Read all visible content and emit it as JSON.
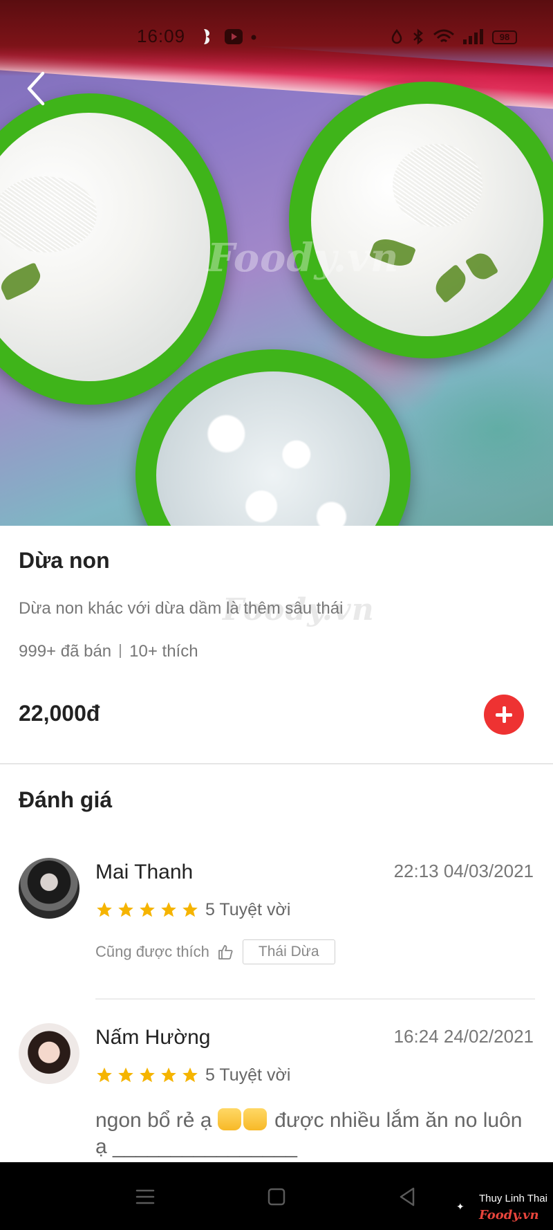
{
  "status_bar": {
    "time": "16:09",
    "battery": "98",
    "icons": [
      "notification-icon",
      "play-icon",
      "dot-icon",
      "alarm-icon",
      "bluetooth-icon",
      "wifi-icon",
      "signal-icon",
      "battery-icon"
    ]
  },
  "hero": {
    "watermark": "Foody.vn"
  },
  "item": {
    "name": "Dừa non",
    "description": "Dừa non  khác với dừa dầm là thêm sâu thái",
    "sold": "999+ đã bán",
    "likes": "10+ thích",
    "price": "22,000đ",
    "watermark": "Foody.vn"
  },
  "reviews": {
    "title": "Đánh giá",
    "items": [
      {
        "name": "Mai Thanh",
        "date": "22:13 04/03/2021",
        "rating": 5,
        "rating_text": "5 Tuyệt vời",
        "liked_label": "Cũng được thích",
        "liked_tag": "Thái Dừa"
      },
      {
        "name": "Nấm Hường",
        "date": "16:24 24/02/2021",
        "rating": 5,
        "rating_text": "5 Tuyệt vời",
        "comment_part1": "ngon bổ rẻ ạ ",
        "comment_part2": " được nhiều lắm ăn no luôn ạ ________________"
      }
    ]
  },
  "footer": {
    "credit_name": "Thuy Linh Thai",
    "credit_brand": "Foody.vn"
  },
  "colors": {
    "accent": "#ee3232",
    "star": "#f5b400",
    "text_primary": "#222222",
    "text_secondary": "#777777"
  }
}
